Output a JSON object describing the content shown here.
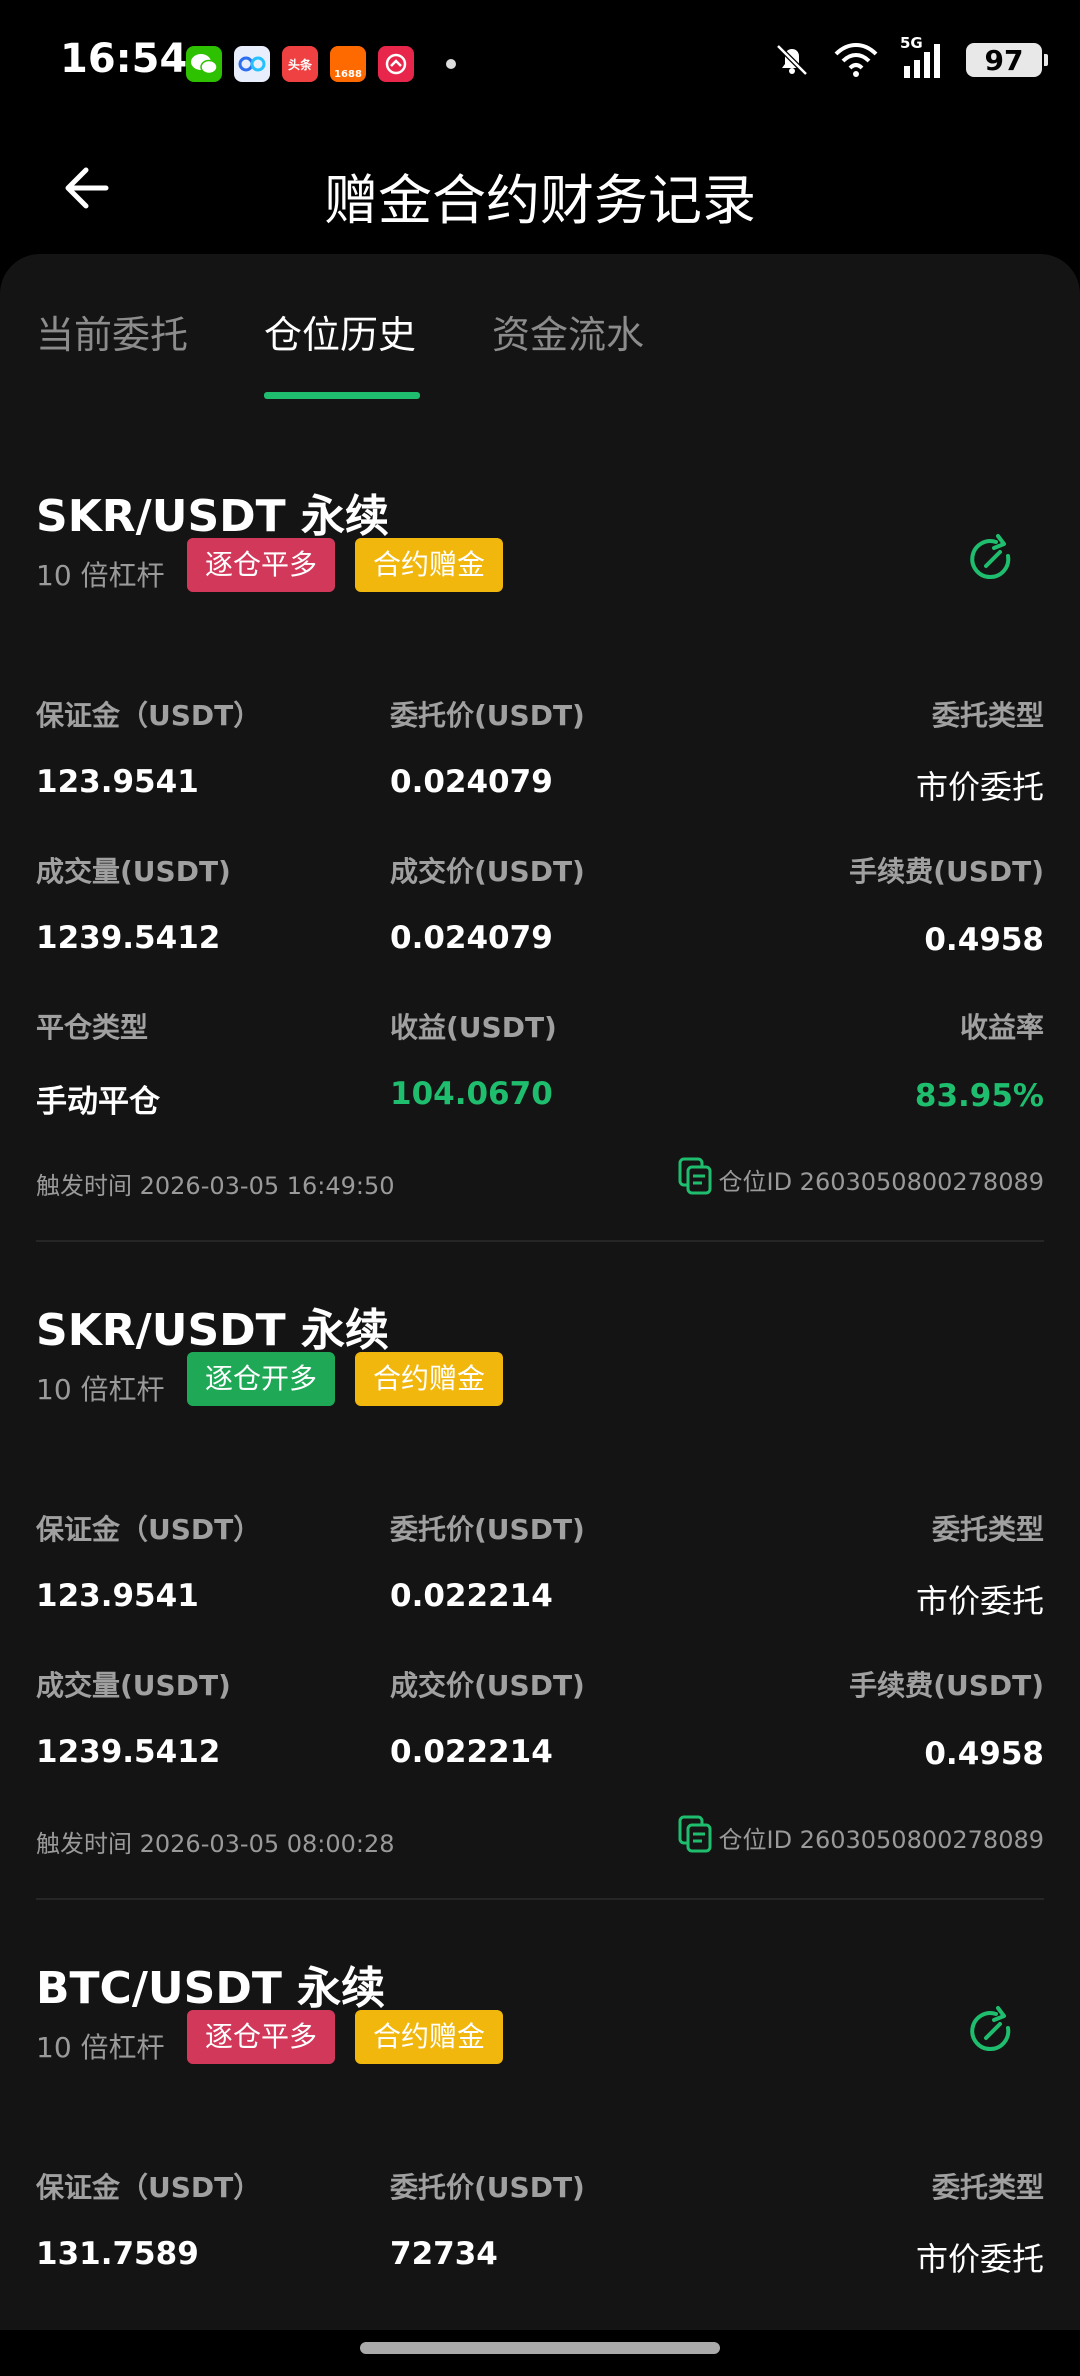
{
  "status": {
    "time": "16:54",
    "battery": "97",
    "network": "5G"
  },
  "status_apps": [
    {
      "name": "wechat-icon",
      "label": "",
      "color": "#2dc100"
    },
    {
      "name": "baidu-netdisk-icon",
      "label": "",
      "color": "#e9eefc"
    },
    {
      "name": "toutiao-icon",
      "label": "头条",
      "color": "#f04142"
    },
    {
      "name": "alibaba-1688-icon",
      "label": "1688",
      "color": "#ff6a00"
    },
    {
      "name": "app-red-icon",
      "label": "",
      "color": "#e8264c"
    }
  ],
  "header": {
    "title": "赠金合约财务记录"
  },
  "tabs": [
    "当前委托",
    "仓位历史",
    "资金流水"
  ],
  "colors": {
    "accent": "#1fbe6e",
    "red_tag": "#d2385a",
    "green_tag": "#1fa957",
    "yellow_tag": "#f1b70d"
  },
  "records": [
    {
      "pair": "SKR/USDT 永续",
      "leverage": "10 倍杠杆",
      "side_tag": "逐仓平多",
      "bonus_tag": "合约赠金",
      "margin_label": "保证金（USDT）",
      "margin": "123.9541",
      "order_price_label": "委托价(USDT)",
      "order_price": "0.024079",
      "order_type_label": "委托类型",
      "order_type": "市价委托",
      "volume_label": "成交量(USDT)",
      "volume": "1239.5412",
      "fill_price_label": "成交价(USDT)",
      "fill_price": "0.024079",
      "fee_label": "手续费(USDT)",
      "fee": "0.4958",
      "close_type_label": "平仓类型",
      "close_type": "手动平仓",
      "pnl_label": "收益(USDT)",
      "pnl": "104.0670",
      "roi_label": "收益率",
      "roi": "83.95%",
      "trigger_time": "触发时间 2026-03-05 16:49:50",
      "position_id": "仓位ID 2603050800278089"
    },
    {
      "pair": "SKR/USDT 永续",
      "leverage": "10 倍杠杆",
      "side_tag": "逐仓开多",
      "bonus_tag": "合约赠金",
      "margin_label": "保证金（USDT）",
      "margin": "123.9541",
      "order_price_label": "委托价(USDT)",
      "order_price": "0.022214",
      "order_type_label": "委托类型",
      "order_type": "市价委托",
      "volume_label": "成交量(USDT)",
      "volume": "1239.5412",
      "fill_price_label": "成交价(USDT)",
      "fill_price": "0.022214",
      "fee_label": "手续费(USDT)",
      "fee": "0.4958",
      "trigger_time": "触发时间 2026-03-05 08:00:28",
      "position_id": "仓位ID 2603050800278089"
    },
    {
      "pair": "BTC/USDT 永续",
      "leverage": "10 倍杠杆",
      "side_tag": "逐仓平多",
      "bonus_tag": "合约赠金",
      "margin_label": "保证金（USDT）",
      "margin": "131.7589",
      "order_price_label": "委托价(USDT)",
      "order_price": "72734",
      "order_type_label": "委托类型",
      "order_type": "市价委托"
    }
  ]
}
